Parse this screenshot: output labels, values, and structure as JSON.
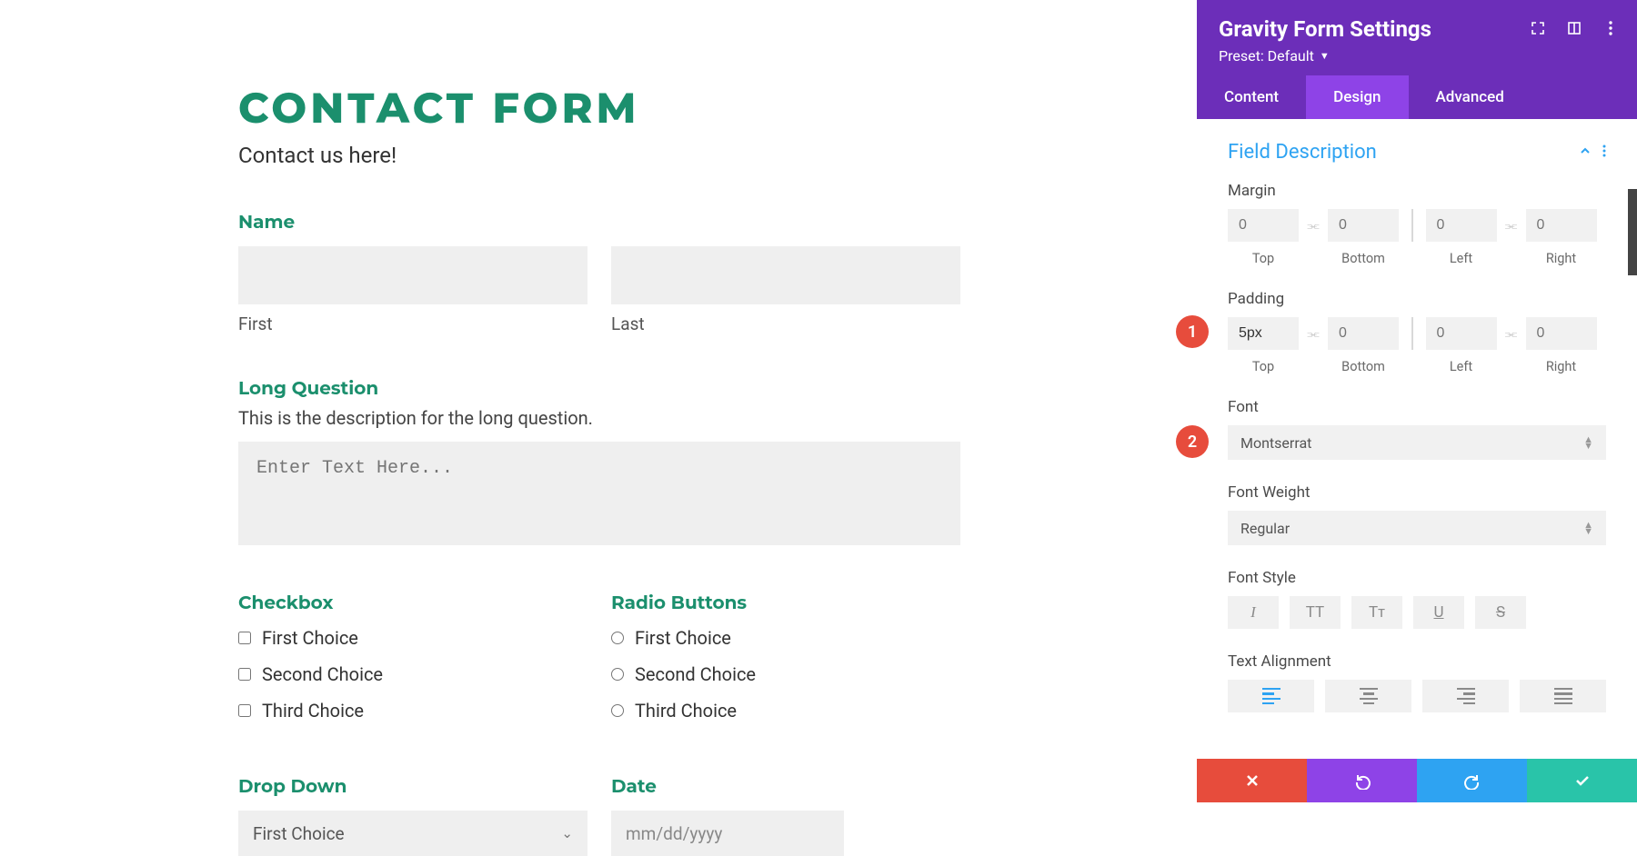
{
  "form": {
    "title": "CONTACT FORM",
    "subtitle": "Contact us here!",
    "name": {
      "label": "Name",
      "first_sublabel": "First",
      "last_sublabel": "Last"
    },
    "long_question": {
      "label": "Long Question",
      "description": "This is the description for the long question.",
      "placeholder": "Enter Text Here..."
    },
    "checkbox": {
      "label": "Checkbox",
      "options": [
        "First Choice",
        "Second Choice",
        "Third Choice"
      ]
    },
    "radio": {
      "label": "Radio Buttons",
      "options": [
        "First Choice",
        "Second Choice",
        "Third Choice"
      ]
    },
    "dropdown": {
      "label": "Drop Down",
      "selected": "First Choice"
    },
    "date": {
      "label": "Date",
      "placeholder": "mm/dd/yyyy"
    }
  },
  "markers": {
    "m1": "1",
    "m2": "2"
  },
  "panel": {
    "title": "Gravity Form Settings",
    "preset_label": "Preset: Default",
    "tabs": {
      "content": "Content",
      "design": "Design",
      "advanced": "Advanced"
    },
    "section_title": "Field Description",
    "margin": {
      "label": "Margin",
      "top": {
        "placeholder": "0",
        "label": "Top"
      },
      "bottom": {
        "placeholder": "0",
        "label": "Bottom"
      },
      "left": {
        "placeholder": "0",
        "label": "Left"
      },
      "right": {
        "placeholder": "0",
        "label": "Right"
      }
    },
    "padding": {
      "label": "Padding",
      "top": {
        "value": "5px",
        "label": "Top"
      },
      "bottom": {
        "placeholder": "0",
        "label": "Bottom"
      },
      "left": {
        "placeholder": "0",
        "label": "Left"
      },
      "right": {
        "placeholder": "0",
        "label": "Right"
      }
    },
    "font": {
      "label": "Font",
      "value": "Montserrat"
    },
    "font_weight": {
      "label": "Font Weight",
      "value": "Regular"
    },
    "font_style": {
      "label": "Font Style",
      "italic": "I",
      "uppercase": "TT",
      "smallcaps": "Tᴛ",
      "underline": "U",
      "strike": "S"
    },
    "text_alignment": {
      "label": "Text Alignment"
    }
  }
}
